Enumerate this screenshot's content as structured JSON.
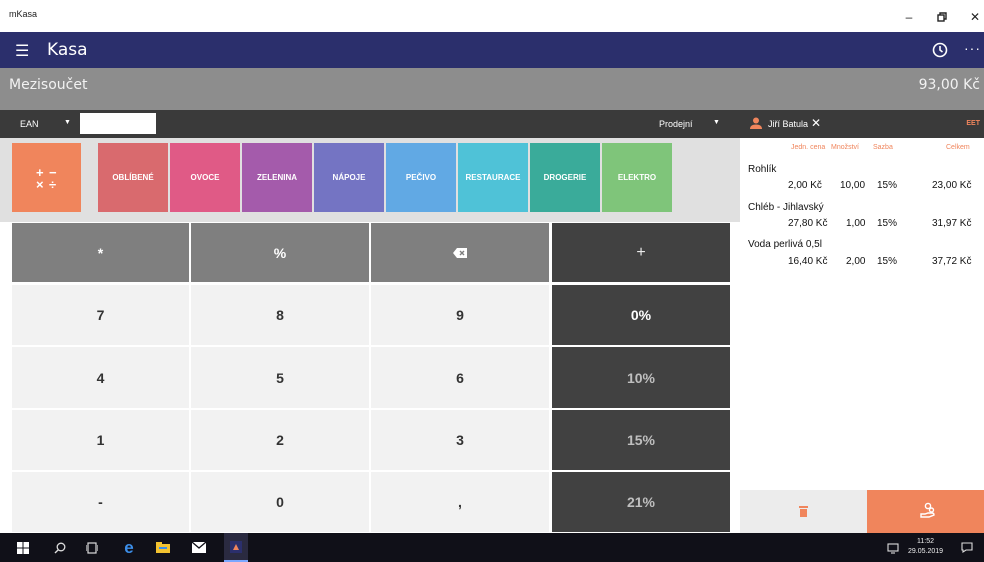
{
  "window": {
    "title": "mKasa"
  },
  "appbar": {
    "title": "Kasa",
    "more": "···"
  },
  "subtotal": {
    "label": "Mezisoučet",
    "amount": "93,00 Kč"
  },
  "toolbar": {
    "ean_label": "EAN",
    "ean_value": "",
    "sale_mode": "Prodejní"
  },
  "categories": [
    {
      "label": "OBLÍBENÉ",
      "color": "#d96a6e"
    },
    {
      "label": "OVOCE",
      "color": "#e05a86"
    },
    {
      "label": "ZELENINA",
      "color": "#a45bab"
    },
    {
      "label": "NÁPOJE",
      "color": "#7474c3"
    },
    {
      "label": "PEČIVO",
      "color": "#61a9e4"
    },
    {
      "label": "RESTAURACE",
      "color": "#4fc2d7"
    },
    {
      "label": "DROGERIE",
      "color": "#3aab9a"
    },
    {
      "label": "ELEKTRO",
      "color": "#7fc57a"
    }
  ],
  "keypad": {
    "row1": [
      "*",
      "%",
      "",
      "+"
    ],
    "digits": [
      [
        "7",
        "8",
        "9"
      ],
      [
        "4",
        "5",
        "6"
      ],
      [
        "1",
        "2",
        "3"
      ],
      [
        "-",
        "0",
        ","
      ]
    ],
    "vat": [
      "0%",
      "10%",
      "15%",
      "21%"
    ]
  },
  "receipt": {
    "user": "Jiří Batula",
    "eet": "EET",
    "columns": {
      "unit_price": "Jedn. cena",
      "qty": "Množství",
      "vat": "Sazba",
      "total": "Celkem"
    },
    "items": [
      {
        "name": "Rohlík",
        "unit_price": "2,00 Kč",
        "qty": "10,00",
        "vat": "15%",
        "total": "23,00 Kč"
      },
      {
        "name": "Chléb - Jihlavský",
        "unit_price": "27,80 Kč",
        "qty": "1,00",
        "vat": "15%",
        "total": "31,97 Kč"
      },
      {
        "name": "Voda perlivá 0,5l",
        "unit_price": "16,40 Kč",
        "qty": "2,00",
        "vat": "15%",
        "total": "37,72 Kč"
      }
    ]
  },
  "taskbar": {
    "time": "11:52",
    "date": "29.05.2019"
  },
  "colors": {
    "appbar": "#2b2f6c",
    "accent": "#f0855c",
    "dark_key": "#414141",
    "gray_key": "#7f7f7f"
  }
}
